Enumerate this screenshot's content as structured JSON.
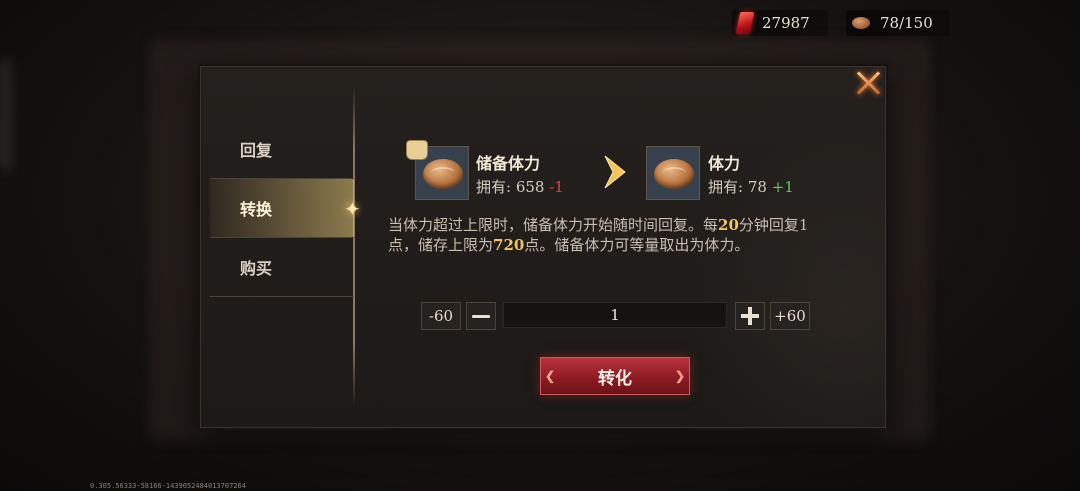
{
  "resources": {
    "gems": "27987",
    "stamina": "78/150"
  },
  "tabs": [
    {
      "label": "回复"
    },
    {
      "label": "转换"
    },
    {
      "label": "购买"
    }
  ],
  "source_item": {
    "name": "储备体力",
    "owned_label": "拥有: 658",
    "delta": "-1"
  },
  "target_item": {
    "name": "体力",
    "owned_label": "拥有: 78",
    "delta": "+1"
  },
  "description": {
    "part1": "当体力超过上限时，储备体力开始随时间回复。每",
    "highlight1": "20",
    "part2": "分钟回复1点，储存上限为",
    "highlight2": "720",
    "part3": "点。储备体力可等量取出为体力。"
  },
  "quantity": {
    "minus60": "-60",
    "plus60": "+60",
    "value": "1"
  },
  "convert_label": "转化",
  "footer_id": "0.305.56333-58166-1439052484013707264",
  "colors": {
    "accent_gold": "#f3c35e",
    "negative": "#e0443a",
    "positive": "#5ec95a",
    "button_red": "#8a1a22"
  },
  "icons": [
    "gem-icon",
    "bread-icon",
    "close-icon",
    "arrow-right-icon",
    "minus-icon",
    "plus-icon",
    "bag-icon"
  ]
}
